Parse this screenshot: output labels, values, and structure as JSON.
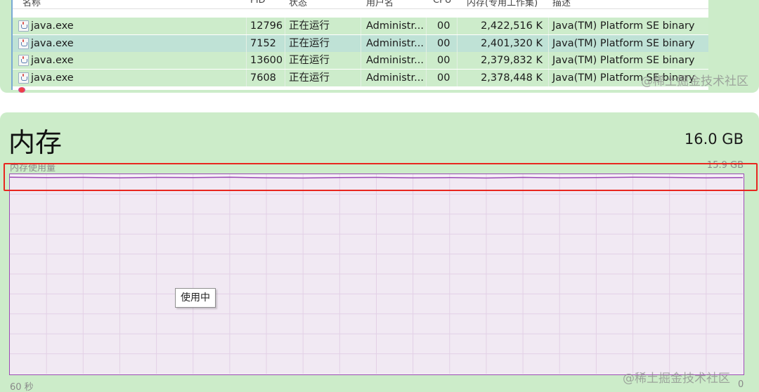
{
  "process_table": {
    "columns": [
      "名称",
      "PID",
      "状态",
      "用户名",
      "CPU",
      "内存(专用工作集)",
      "描述"
    ],
    "rows": [
      {
        "name": "java.exe",
        "pid": "12796",
        "status": "正在运行",
        "user": "Administr...",
        "cpu": "00",
        "memory": "2,422,516 K",
        "description": "Java(TM) Platform SE binary",
        "selected": false
      },
      {
        "name": "java.exe",
        "pid": "7152",
        "status": "正在运行",
        "user": "Administr...",
        "cpu": "00",
        "memory": "2,401,320 K",
        "description": "Java(TM) Platform SE binary",
        "selected": true
      },
      {
        "name": "java.exe",
        "pid": "13600",
        "status": "正在运行",
        "user": "Administr...",
        "cpu": "00",
        "memory": "2,379,832 K",
        "description": "Java(TM) Platform SE binary",
        "selected": false
      },
      {
        "name": "java.exe",
        "pid": "7608",
        "status": "正在运行",
        "user": "Administr...",
        "cpu": "00",
        "memory": "2,378,448 K",
        "description": "Java(TM) Platform SE binary",
        "selected": false
      }
    ],
    "icon": "java-exe-icon"
  },
  "memory": {
    "title": "内存",
    "total": "16.0 GB",
    "usage_label": "内存使用量",
    "usage_max": "15.9 GB",
    "tooltip": "使用中",
    "axis_left": "60 秒",
    "axis_right": "0",
    "line_color": "#9b4bb4",
    "usage_series_fraction": [
      0.985,
      0.983,
      0.984,
      0.982,
      0.984,
      0.983,
      0.985,
      0.982,
      0.981,
      0.983,
      0.984,
      0.982,
      0.983,
      0.981,
      0.984,
      0.982,
      0.983,
      0.985,
      0.984,
      0.982,
      0.983
    ]
  },
  "watermarks": [
    "@稀土掘金技术社区",
    "@稀土掘金技术社区"
  ],
  "highlight_color": "#e8261f"
}
